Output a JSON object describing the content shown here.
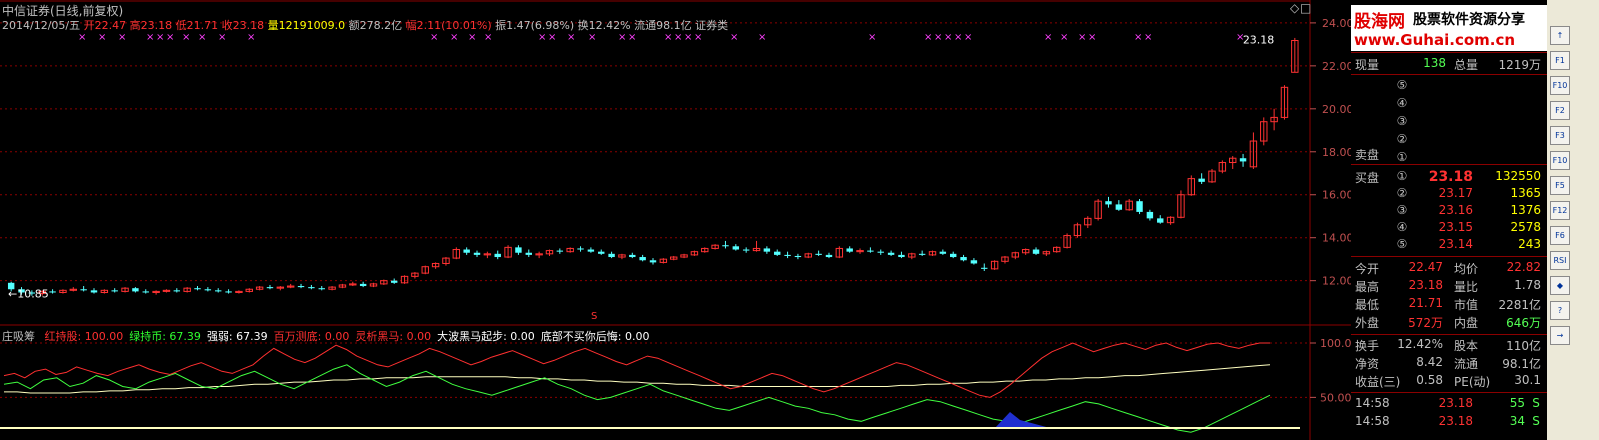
{
  "header": {
    "title": "中信证券(日线,前复权)",
    "date": "2014/12/05/五",
    "open_label": "开",
    "open": "22.47",
    "high_label": "高",
    "high": "23.18",
    "low_label": "低",
    "low": "21.71",
    "close_label": "收",
    "close": "23.18",
    "volume_label": "量",
    "volume": "12191009.0",
    "amount_label": "额",
    "amount": "278.2亿",
    "change_label": "幅",
    "change": "2.11(10.01%)",
    "amplitude_label": "振",
    "amplitude": "1.47(6.98%)",
    "turnover_label": "换",
    "turnover": "12.42%",
    "float_label": "流通",
    "float": "98.1亿",
    "sector": "证券类",
    "corner_icon": "diamond-icon"
  },
  "indicator": {
    "name": "庄吸筹",
    "items": [
      {
        "label": "红持股:",
        "value": "100.00",
        "color": "#ff3030"
      },
      {
        "label": "绿持币:",
        "value": "67.39",
        "color": "#30ff30"
      },
      {
        "label": "强弱:",
        "value": "67.39",
        "color": "#ffffff"
      },
      {
        "label": "百万测底:",
        "value": "0.00",
        "color": "#ff3030"
      },
      {
        "label": "灵析黑马:",
        "value": "0.00",
        "color": "#ff3030"
      },
      {
        "label": "大波黑马起步:",
        "value": "0.00",
        "color": "#ffffff"
      },
      {
        "label": "底部不买你后悔:",
        "value": "0.00",
        "color": "#ffffff"
      }
    ],
    "axis": [
      "100.0",
      "50.00"
    ]
  },
  "price_annotations": {
    "last": "23.18",
    "low": "10.85",
    "marker": "S"
  },
  "chart_data": {
    "type": "candlestick",
    "ylim": [
      11.1,
      24.6
    ],
    "yticks": [
      "24.00",
      "22.00",
      "20.00",
      "18.00",
      "16.00",
      "14.00",
      "12.00"
    ],
    "candles": [
      [
        11.9,
        11.95,
        11.5,
        11.6
      ],
      [
        11.6,
        11.7,
        11.35,
        11.45
      ],
      [
        11.45,
        11.55,
        11.3,
        11.4
      ],
      [
        11.4,
        11.55,
        11.3,
        11.5
      ],
      [
        11.5,
        11.6,
        11.4,
        11.45
      ],
      [
        11.45,
        11.6,
        11.4,
        11.55
      ],
      [
        11.55,
        11.7,
        11.5,
        11.6
      ],
      [
        11.6,
        11.75,
        11.5,
        11.55
      ],
      [
        11.55,
        11.65,
        11.4,
        11.45
      ],
      [
        11.45,
        11.6,
        11.4,
        11.55
      ],
      [
        11.55,
        11.65,
        11.45,
        11.5
      ],
      [
        11.5,
        11.7,
        11.45,
        11.65
      ],
      [
        11.65,
        11.7,
        11.45,
        11.5
      ],
      [
        11.5,
        11.6,
        11.4,
        11.45
      ],
      [
        11.45,
        11.55,
        11.35,
        11.5
      ],
      [
        11.5,
        11.6,
        11.45,
        11.55
      ],
      [
        11.55,
        11.65,
        11.45,
        11.5
      ],
      [
        11.5,
        11.7,
        11.45,
        11.65
      ],
      [
        11.65,
        11.75,
        11.55,
        11.6
      ],
      [
        11.6,
        11.7,
        11.5,
        11.55
      ],
      [
        11.55,
        11.65,
        11.45,
        11.5
      ],
      [
        11.5,
        11.6,
        11.4,
        11.45
      ],
      [
        11.45,
        11.55,
        11.4,
        11.5
      ],
      [
        11.5,
        11.65,
        11.45,
        11.6
      ],
      [
        11.6,
        11.75,
        11.55,
        11.7
      ],
      [
        11.7,
        11.8,
        11.6,
        11.65
      ],
      [
        11.65,
        11.75,
        11.55,
        11.7
      ],
      [
        11.7,
        11.85,
        11.65,
        11.75
      ],
      [
        11.75,
        11.85,
        11.65,
        11.7
      ],
      [
        11.7,
        11.8,
        11.6,
        11.65
      ],
      [
        11.65,
        11.75,
        11.55,
        11.6
      ],
      [
        11.6,
        11.75,
        11.55,
        11.7
      ],
      [
        11.7,
        11.85,
        11.65,
        11.8
      ],
      [
        11.8,
        11.95,
        11.75,
        11.85
      ],
      [
        11.85,
        11.95,
        11.7,
        11.75
      ],
      [
        11.75,
        11.9,
        11.7,
        11.85
      ],
      [
        11.85,
        12.05,
        11.8,
        12.0
      ],
      [
        12.0,
        12.1,
        11.85,
        11.9
      ],
      [
        11.9,
        12.25,
        11.85,
        12.2
      ],
      [
        12.2,
        12.4,
        12.1,
        12.35
      ],
      [
        12.35,
        12.7,
        12.3,
        12.65
      ],
      [
        12.65,
        12.85,
        12.55,
        12.8
      ],
      [
        12.8,
        13.1,
        12.7,
        13.05
      ],
      [
        13.05,
        13.55,
        13.0,
        13.45
      ],
      [
        13.45,
        13.55,
        13.2,
        13.3
      ],
      [
        13.3,
        13.4,
        13.1,
        13.2
      ],
      [
        13.2,
        13.35,
        13.05,
        13.25
      ],
      [
        13.25,
        13.4,
        13.0,
        13.1
      ],
      [
        13.1,
        13.65,
        13.05,
        13.55
      ],
      [
        13.55,
        13.65,
        13.2,
        13.3
      ],
      [
        13.3,
        13.45,
        13.1,
        13.2
      ],
      [
        13.2,
        13.35,
        13.05,
        13.25
      ],
      [
        13.25,
        13.45,
        13.15,
        13.4
      ],
      [
        13.4,
        13.5,
        13.25,
        13.35
      ],
      [
        13.35,
        13.55,
        13.3,
        13.5
      ],
      [
        13.5,
        13.6,
        13.35,
        13.45
      ],
      [
        13.45,
        13.55,
        13.3,
        13.35
      ],
      [
        13.35,
        13.45,
        13.2,
        13.25
      ],
      [
        13.25,
        13.35,
        13.05,
        13.1
      ],
      [
        13.1,
        13.25,
        13.0,
        13.2
      ],
      [
        13.2,
        13.3,
        13.05,
        13.1
      ],
      [
        13.1,
        13.2,
        12.9,
        12.95
      ],
      [
        12.95,
        13.05,
        12.75,
        12.85
      ],
      [
        12.85,
        13.05,
        12.8,
        13.0
      ],
      [
        13.0,
        13.15,
        12.95,
        13.1
      ],
      [
        13.1,
        13.25,
        13.05,
        13.2
      ],
      [
        13.2,
        13.4,
        13.15,
        13.35
      ],
      [
        13.35,
        13.55,
        13.3,
        13.5
      ],
      [
        13.5,
        13.7,
        13.45,
        13.65
      ],
      [
        13.65,
        13.85,
        13.5,
        13.6
      ],
      [
        13.6,
        13.7,
        13.4,
        13.45
      ],
      [
        13.45,
        13.55,
        13.3,
        13.4
      ],
      [
        13.4,
        13.85,
        13.35,
        13.5
      ],
      [
        13.5,
        13.6,
        13.25,
        13.35
      ],
      [
        13.35,
        13.45,
        13.15,
        13.2
      ],
      [
        13.2,
        13.35,
        13.05,
        13.15
      ],
      [
        13.15,
        13.25,
        13.0,
        13.1
      ],
      [
        13.1,
        13.3,
        13.05,
        13.25
      ],
      [
        13.25,
        13.4,
        13.15,
        13.2
      ],
      [
        13.2,
        13.3,
        13.05,
        13.1
      ],
      [
        13.1,
        13.6,
        13.05,
        13.5
      ],
      [
        13.5,
        13.6,
        13.3,
        13.35
      ],
      [
        13.35,
        13.5,
        13.25,
        13.4
      ],
      [
        13.4,
        13.55,
        13.3,
        13.35
      ],
      [
        13.35,
        13.45,
        13.2,
        13.3
      ],
      [
        13.3,
        13.4,
        13.15,
        13.2
      ],
      [
        13.2,
        13.35,
        13.05,
        13.1
      ],
      [
        13.1,
        13.3,
        13.0,
        13.25
      ],
      [
        13.25,
        13.4,
        13.15,
        13.2
      ],
      [
        13.2,
        13.4,
        13.15,
        13.35
      ],
      [
        13.35,
        13.45,
        13.2,
        13.25
      ],
      [
        13.25,
        13.35,
        13.05,
        13.1
      ],
      [
        13.1,
        13.2,
        12.9,
        12.95
      ],
      [
        12.95,
        13.05,
        12.75,
        12.8
      ],
      [
        12.6,
        12.8,
        12.45,
        12.55
      ],
      [
        12.55,
        12.95,
        12.5,
        12.9
      ],
      [
        12.9,
        13.15,
        12.8,
        13.1
      ],
      [
        13.1,
        13.35,
        13.0,
        13.3
      ],
      [
        13.3,
        13.5,
        13.2,
        13.45
      ],
      [
        13.45,
        13.55,
        13.2,
        13.25
      ],
      [
        13.25,
        13.4,
        13.15,
        13.35
      ],
      [
        13.35,
        13.6,
        13.3,
        13.55
      ],
      [
        13.55,
        14.2,
        13.5,
        14.1
      ],
      [
        14.1,
        14.7,
        14.0,
        14.6
      ],
      [
        14.6,
        15.0,
        14.45,
        14.9
      ],
      [
        14.9,
        15.8,
        14.8,
        15.7
      ],
      [
        15.7,
        15.9,
        15.4,
        15.55
      ],
      [
        15.55,
        15.75,
        15.25,
        15.3
      ],
      [
        15.3,
        15.8,
        15.25,
        15.7
      ],
      [
        15.7,
        15.8,
        15.1,
        15.2
      ],
      [
        15.2,
        15.3,
        14.8,
        14.9
      ],
      [
        14.9,
        15.05,
        14.65,
        14.7
      ],
      [
        14.7,
        15.0,
        14.6,
        14.95
      ],
      [
        14.95,
        16.2,
        14.9,
        16.0
      ],
      [
        16.0,
        16.9,
        15.95,
        16.75
      ],
      [
        16.75,
        17.0,
        16.5,
        16.6
      ],
      [
        16.6,
        17.2,
        16.55,
        17.1
      ],
      [
        17.1,
        17.6,
        17.0,
        17.5
      ],
      [
        17.5,
        17.8,
        17.2,
        17.7
      ],
      [
        17.7,
        17.9,
        17.3,
        17.55
      ],
      [
        17.3,
        18.9,
        17.2,
        18.5
      ],
      [
        18.5,
        19.6,
        18.3,
        19.4
      ],
      [
        19.4,
        20.0,
        19.0,
        19.6
      ],
      [
        19.6,
        21.1,
        19.5,
        21.0
      ],
      [
        21.7,
        23.3,
        21.7,
        23.18
      ]
    ],
    "indicator_red": [
      70,
      72,
      68,
      74,
      76,
      71,
      73,
      78,
      75,
      72,
      70,
      74,
      77,
      80,
      76,
      73,
      71,
      75,
      79,
      82,
      78,
      74,
      72,
      76,
      80,
      88,
      95,
      90,
      85,
      82,
      86,
      92,
      98,
      94,
      88,
      84,
      80,
      78,
      82,
      86,
      90,
      95,
      92,
      88,
      84,
      80,
      83,
      87,
      90,
      93,
      89,
      85,
      81,
      84,
      88,
      92,
      95,
      91,
      87,
      83,
      80,
      84,
      88,
      86,
      82,
      78,
      74,
      70,
      66,
      62,
      58,
      60,
      64,
      68,
      72,
      70,
      66,
      62,
      58,
      55,
      58,
      62,
      66,
      70,
      74,
      78,
      82,
      80,
      76,
      72,
      68,
      64,
      60,
      56,
      52,
      50,
      55,
      62,
      70,
      78,
      86,
      92,
      96,
      100,
      96,
      92,
      95,
      98,
      100,
      97,
      94,
      98,
      100,
      96,
      93,
      96,
      99,
      100,
      97,
      95,
      98,
      100,
      100
    ],
    "indicator_green": [
      62,
      64,
      58,
      66,
      68,
      60,
      63,
      70,
      66,
      60,
      58,
      64,
      68,
      72,
      66,
      60,
      58,
      64,
      70,
      74,
      68,
      62,
      58,
      64,
      70,
      76,
      80,
      72,
      66,
      60,
      64,
      70,
      74,
      68,
      62,
      58,
      55,
      52,
      56,
      60,
      64,
      68,
      62,
      58,
      52,
      48,
      50,
      54,
      58,
      62,
      56,
      52,
      48,
      44,
      40,
      38,
      42,
      46,
      50,
      46,
      42,
      40,
      36,
      34,
      30,
      28,
      32,
      36,
      40,
      44,
      48,
      46,
      42,
      38,
      34,
      30,
      28,
      26,
      30,
      34,
      38,
      42,
      46,
      44,
      40,
      36,
      32,
      28,
      24,
      20,
      18,
      22,
      28,
      34,
      40,
      46,
      52
    ],
    "indicator_ma": [
      55,
      55,
      54,
      54,
      54,
      54,
      55,
      55,
      56,
      56,
      57,
      57,
      58,
      58,
      59,
      59,
      60,
      60,
      61,
      62,
      62,
      63,
      64,
      64,
      65,
      66,
      66,
      67,
      67,
      68,
      68,
      68,
      69,
      69,
      69,
      69,
      69,
      69,
      69,
      68,
      68,
      67,
      67,
      66,
      66,
      65,
      65,
      64,
      64,
      63,
      63,
      62,
      62,
      61,
      61,
      61,
      60,
      60,
      60,
      60,
      60,
      60,
      60,
      60,
      60,
      60,
      60,
      60,
      61,
      61,
      62,
      62,
      63,
      63,
      64,
      64,
      65,
      65,
      66,
      66,
      67,
      67,
      68,
      68,
      69,
      70,
      70,
      71,
      72,
      73,
      74,
      75,
      76,
      77,
      78,
      79,
      80
    ]
  },
  "quote_panel": {
    "logo_brand": "股海网",
    "logo_slogan": "股票软件资源分享",
    "logo_url": "www.Guhai.com.cn",
    "now_vol_label": "现量",
    "now_vol": "138",
    "total_vol_label": "总量",
    "total_vol": "1219万",
    "sell_label": "卖盘",
    "buy_label": "买盘",
    "sell_levels": [
      {
        "num": "⑤",
        "price": "",
        "vol": ""
      },
      {
        "num": "④",
        "price": "",
        "vol": ""
      },
      {
        "num": "③",
        "price": "",
        "vol": ""
      },
      {
        "num": "②",
        "price": "",
        "vol": ""
      },
      {
        "num": "①",
        "price": "",
        "vol": ""
      }
    ],
    "buy_levels": [
      {
        "num": "①",
        "price": "23.18",
        "vol": "132550"
      },
      {
        "num": "②",
        "price": "23.17",
        "vol": "1365"
      },
      {
        "num": "③",
        "price": "23.16",
        "vol": "1376"
      },
      {
        "num": "④",
        "price": "23.15",
        "vol": "2578"
      },
      {
        "num": "⑤",
        "price": "23.14",
        "vol": "243"
      }
    ],
    "stats": [
      {
        "l1": "今开",
        "v1": "22.47",
        "l2": "均价",
        "v2": "22.82"
      },
      {
        "l1": "最高",
        "v1": "23.18",
        "l2": "量比",
        "v2": "1.78"
      },
      {
        "l1": "最低",
        "v1": "21.71",
        "l2": "市值",
        "v2": "2281亿"
      },
      {
        "l1": "外盘",
        "v1": "572万",
        "l2": "内盘",
        "v2": "646万"
      }
    ],
    "stats2": [
      {
        "l1": "换手",
        "v1": "12.42%",
        "l2": "股本",
        "v2": "110亿"
      },
      {
        "l1": "净资",
        "v1": "8.42",
        "l2": "流通",
        "v2": "98.1亿"
      },
      {
        "l1": "收益(三)",
        "v1": "0.58",
        "l2": "PE(动)",
        "v2": "30.1"
      }
    ],
    "ticks": [
      {
        "time": "14:58",
        "price": "23.18",
        "vol": "55",
        "side": "S"
      },
      {
        "time": "14:58",
        "price": "23.18",
        "vol": "34",
        "side": "S"
      }
    ]
  },
  "toolbar": {
    "buttons": [
      "↑",
      "F1",
      "F10",
      "F2",
      "F3",
      "F10",
      "F5",
      "F12",
      "F6",
      "RSI",
      "◆",
      "?",
      "→"
    ]
  },
  "colors": {
    "up": "#ff3232",
    "down": "#54ffff",
    "grid": "#8b0000",
    "axis": "#c05050",
    "indicator_red": "#ff3030",
    "indicator_green": "#40ff40",
    "indicator_ma": "#ffffc0"
  }
}
